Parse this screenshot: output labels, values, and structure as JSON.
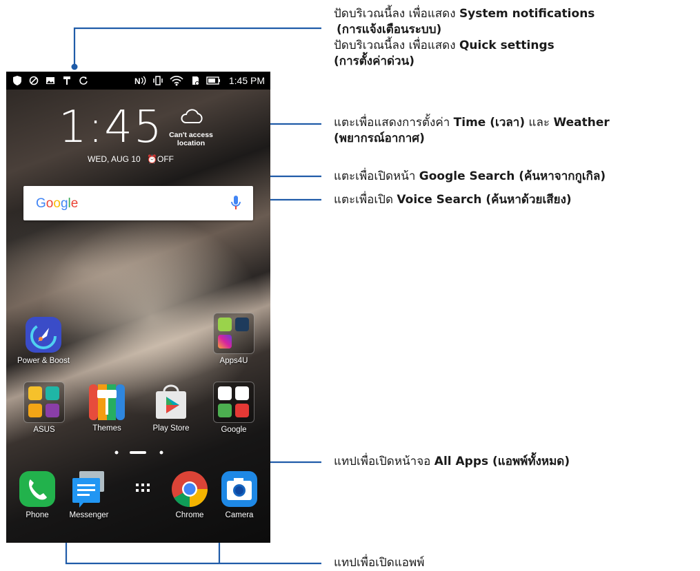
{
  "status_bar": {
    "time": "1:45 PM",
    "left_icons": [
      "shield-icon",
      "blocked-icon",
      "image-icon",
      "paint-roller-icon",
      "sync-icon"
    ],
    "right_icons": [
      "nfc-icon",
      "vibrate-icon",
      "wifi-icon",
      "sd-card-icon",
      "battery-icon"
    ]
  },
  "clock_widget": {
    "time": "1:45",
    "date": "WED, AUG 10",
    "alarm": "OFF",
    "weather_text": "Can't access location"
  },
  "search_bar": {
    "logo": "Google"
  },
  "apps": {
    "power_boost": "Power & Boost",
    "apps4u": "Apps4U",
    "asus": "ASUS",
    "themes": "Themes",
    "play_store": "Play Store",
    "google": "Google",
    "phone": "Phone",
    "messenger": "Messenger",
    "chrome": "Chrome",
    "camera": "Camera"
  },
  "annotations": {
    "status": {
      "line1_pre": "ปัดบริเวณนี้ลง เพื่อแสดง ",
      "line1_bold": "System notifications",
      "line2_bold": "(การแจ้งเตือนระบบ)",
      "line3_pre": "ปัดบริเวณนี้ลง เพื่อแสดง ",
      "line3_bold": "Quick settings",
      "line4_bold": "(การตั้งค่าด่วน)"
    },
    "weather": {
      "line1_pre": "แตะเพื่อแสดงการตั้งค่า ",
      "line1_bold1": "Time (เวลา)",
      "line1_mid": " และ ",
      "line1_bold2": "Weather",
      "line2_bold": "(พยากรณ์อากาศ)"
    },
    "google_search": {
      "pre": "แตะเพื่อเปิดหน้า ",
      "bold": "Google Search (ค้นหาจากกูเกิล)"
    },
    "voice_search": {
      "pre": "แตะเพื่อเปิด ",
      "bold": "Voice Search (ค้นหาด้วยเสียง)"
    },
    "all_apps": {
      "pre": "แทปเพื่อเปิดหน้าจอ ",
      "bold": "All Apps (แอพพ์ทั้งหมด)"
    },
    "open_apps": {
      "text": "แทปเพื่อเปิดแอพพ์"
    }
  },
  "colors": {
    "callout_line": "#1f5ba8",
    "status_bar": "#000000"
  }
}
